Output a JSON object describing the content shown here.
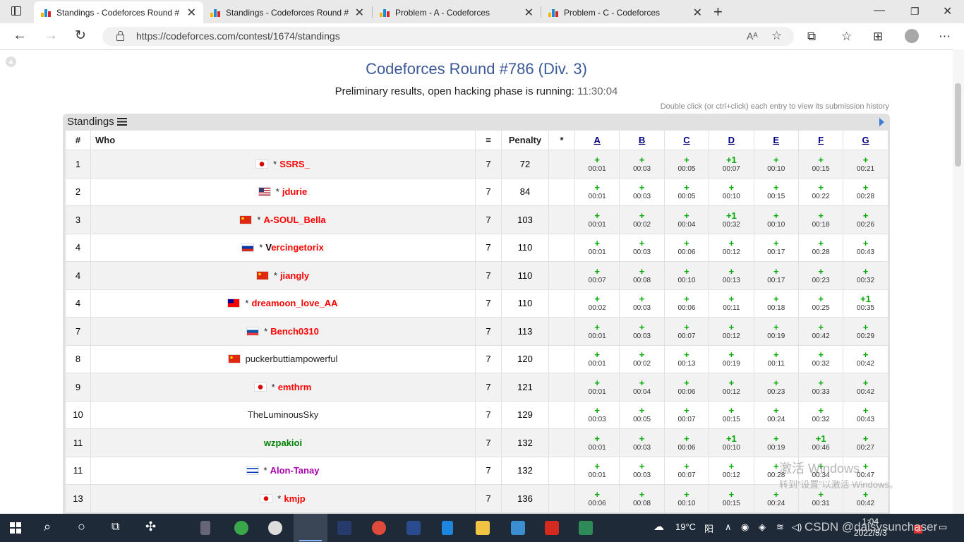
{
  "browser": {
    "tabs": [
      {
        "title": "Standings - Codeforces Round #",
        "active": true
      },
      {
        "title": "Standings - Codeforces Round #",
        "active": false
      },
      {
        "title": "Problem - A - Codeforces",
        "active": false
      },
      {
        "title": "Problem - C - Codeforces",
        "active": false
      }
    ],
    "url": "https://codeforces.com/contest/1674/standings",
    "read_aloud_label": "Aᴬ"
  },
  "page": {
    "contest_title": "Codeforces Round #786 (Div. 3)",
    "status_text": "Preliminary results, open hacking phase is running:",
    "timer": "11:30:04",
    "hint": "Double click (or ctrl+click) each entry to view its submission history",
    "standings_caption": "Standings"
  },
  "table": {
    "headers": {
      "rank": "#",
      "who": "Who",
      "solved": "=",
      "penalty": "Penalty",
      "hacks": "*"
    },
    "problems": [
      "A",
      "B",
      "C",
      "D",
      "E",
      "F",
      "G"
    ],
    "rows": [
      {
        "rank": "1",
        "flag": "jp",
        "party": "*",
        "handle": "SSRS_",
        "color": "red",
        "solved": "7",
        "penalty": "72",
        "cells": [
          [
            "+",
            "00:01"
          ],
          [
            "+",
            "00:03"
          ],
          [
            "+",
            "00:05"
          ],
          [
            "+1",
            "00:07"
          ],
          [
            "+",
            "00:10"
          ],
          [
            "+",
            "00:15"
          ],
          [
            "+",
            "00:21"
          ]
        ]
      },
      {
        "rank": "2",
        "flag": "us",
        "party": "*",
        "handle": "jdurie",
        "color": "red",
        "solved": "7",
        "penalty": "84",
        "cells": [
          [
            "+",
            "00:01"
          ],
          [
            "+",
            "00:03"
          ],
          [
            "+",
            "00:05"
          ],
          [
            "+",
            "00:10"
          ],
          [
            "+",
            "00:15"
          ],
          [
            "+",
            "00:22"
          ],
          [
            "+",
            "00:28"
          ]
        ]
      },
      {
        "rank": "3",
        "flag": "cn",
        "party": "*",
        "handle": "A-SOUL_Bella",
        "color": "red",
        "solved": "7",
        "penalty": "103",
        "cells": [
          [
            "+",
            "00:01"
          ],
          [
            "+",
            "00:02"
          ],
          [
            "+",
            "00:04"
          ],
          [
            "+1",
            "00:32"
          ],
          [
            "+",
            "00:10"
          ],
          [
            "+",
            "00:18"
          ],
          [
            "+",
            "00:26"
          ]
        ]
      },
      {
        "rank": "4",
        "flag": "ru",
        "party": "*",
        "handle": "Vercingetorix",
        "color": "legendary",
        "solved": "7",
        "penalty": "110",
        "cells": [
          [
            "+",
            "00:01"
          ],
          [
            "+",
            "00:03"
          ],
          [
            "+",
            "00:06"
          ],
          [
            "+",
            "00:12"
          ],
          [
            "+",
            "00:17"
          ],
          [
            "+",
            "00:28"
          ],
          [
            "+",
            "00:43"
          ]
        ]
      },
      {
        "rank": "4",
        "flag": "cn",
        "party": "*",
        "handle": "jiangly",
        "color": "red",
        "solved": "7",
        "penalty": "110",
        "cells": [
          [
            "+",
            "00:07"
          ],
          [
            "+",
            "00:08"
          ],
          [
            "+",
            "00:10"
          ],
          [
            "+",
            "00:13"
          ],
          [
            "+",
            "00:17"
          ],
          [
            "+",
            "00:23"
          ],
          [
            "+",
            "00:32"
          ]
        ]
      },
      {
        "rank": "4",
        "flag": "tw",
        "party": "*",
        "handle": "dreamoon_love_AA",
        "color": "red",
        "solved": "7",
        "penalty": "110",
        "cells": [
          [
            "+",
            "00:02"
          ],
          [
            "+",
            "00:03"
          ],
          [
            "+",
            "00:06"
          ],
          [
            "+",
            "00:11"
          ],
          [
            "+",
            "00:18"
          ],
          [
            "+",
            "00:25"
          ],
          [
            "+1",
            "00:35"
          ]
        ]
      },
      {
        "rank": "7",
        "flag": "si",
        "party": "*",
        "handle": "Bench0310",
        "color": "red",
        "solved": "7",
        "penalty": "113",
        "cells": [
          [
            "+",
            "00:01"
          ],
          [
            "+",
            "00:03"
          ],
          [
            "+",
            "00:07"
          ],
          [
            "+",
            "00:12"
          ],
          [
            "+",
            "00:19"
          ],
          [
            "+",
            "00:42"
          ],
          [
            "+",
            "00:29"
          ]
        ]
      },
      {
        "rank": "8",
        "flag": "cn",
        "party": "",
        "handle": "puckerbuttiampowerful",
        "color": "plain",
        "solved": "7",
        "penalty": "120",
        "cells": [
          [
            "+",
            "00:01"
          ],
          [
            "+",
            "00:02"
          ],
          [
            "+",
            "00:13"
          ],
          [
            "+",
            "00:19"
          ],
          [
            "+",
            "00:11"
          ],
          [
            "+",
            "00:32"
          ],
          [
            "+",
            "00:42"
          ]
        ]
      },
      {
        "rank": "9",
        "flag": "jp",
        "party": "*",
        "handle": "emthrm",
        "color": "red",
        "solved": "7",
        "penalty": "121",
        "cells": [
          [
            "+",
            "00:01"
          ],
          [
            "+",
            "00:04"
          ],
          [
            "+",
            "00:06"
          ],
          [
            "+",
            "00:12"
          ],
          [
            "+",
            "00:23"
          ],
          [
            "+",
            "00:33"
          ],
          [
            "+",
            "00:42"
          ]
        ]
      },
      {
        "rank": "10",
        "flag": "",
        "party": "",
        "handle": "TheLuminousSky",
        "color": "plain",
        "solved": "7",
        "penalty": "129",
        "cells": [
          [
            "+",
            "00:03"
          ],
          [
            "+",
            "00:05"
          ],
          [
            "+",
            "00:07"
          ],
          [
            "+",
            "00:15"
          ],
          [
            "+",
            "00:24"
          ],
          [
            "+",
            "00:32"
          ],
          [
            "+",
            "00:43"
          ]
        ]
      },
      {
        "rank": "11",
        "flag": "",
        "party": "",
        "handle": "wzpakioi",
        "color": "green",
        "solved": "7",
        "penalty": "132",
        "cells": [
          [
            "+",
            "00:01"
          ],
          [
            "+",
            "00:03"
          ],
          [
            "+",
            "00:06"
          ],
          [
            "+1",
            "00:10"
          ],
          [
            "+",
            "00:19"
          ],
          [
            "+1",
            "00:46"
          ],
          [
            "+",
            "00:27"
          ]
        ]
      },
      {
        "rank": "11",
        "flag": "il",
        "party": "*",
        "handle": "Alon-Tanay",
        "color": "violet",
        "solved": "7",
        "penalty": "132",
        "cells": [
          [
            "+",
            "00:01"
          ],
          [
            "+",
            "00:03"
          ],
          [
            "+",
            "00:07"
          ],
          [
            "+",
            "00:12"
          ],
          [
            "+",
            "00:28"
          ],
          [
            "+",
            "00:34"
          ],
          [
            "+",
            "00:47"
          ]
        ]
      },
      {
        "rank": "13",
        "flag": "jp",
        "party": "*",
        "handle": "kmjp",
        "color": "red",
        "solved": "7",
        "penalty": "136",
        "cells": [
          [
            "+",
            "00:06"
          ],
          [
            "+",
            "00:08"
          ],
          [
            "+",
            "00:10"
          ],
          [
            "+",
            "00:15"
          ],
          [
            "+",
            "00:24"
          ],
          [
            "+",
            "00:31"
          ],
          [
            "+",
            "00:42"
          ]
        ]
      }
    ]
  },
  "watermark": {
    "line1": "激活 Windows",
    "line2": "转到“设置”以激活 Windows。"
  },
  "taskbar": {
    "weather": "19°C",
    "ime": "阳",
    "time": "1:04",
    "date": "2022/5/3",
    "csdn_watermark": "CSDN @daisysunchaser"
  }
}
